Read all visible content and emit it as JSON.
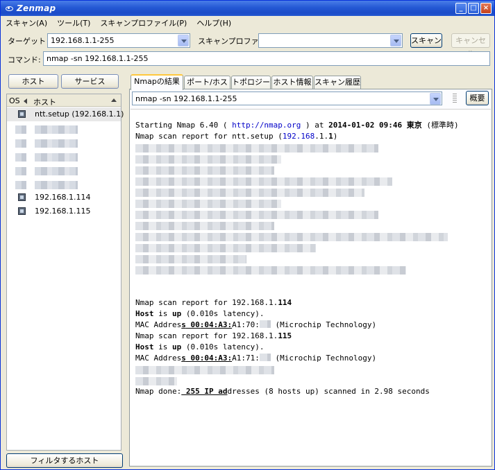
{
  "window": {
    "title": "Zenmap"
  },
  "menu": [
    "スキャン(A)",
    "ツール(T)",
    "スキャンプロファイル(P)",
    "ヘルプ(H)"
  ],
  "target": {
    "label": "ターゲット",
    "value": "192.168.1.1-255"
  },
  "profile": {
    "label": "スキャンプロファイル",
    "value": ""
  },
  "buttons": {
    "scan": "スキャン",
    "cancel": "キャンセル",
    "filter_hosts": "フィルタするホスト"
  },
  "command": {
    "label": "コマンド:",
    "value": "nmap -sn 192.168.1.1-255"
  },
  "host_tabs": {
    "hosts": "ホスト",
    "services": "サービス"
  },
  "host_list": {
    "col_os": "OS",
    "col_host": "ホスト",
    "hosts": [
      "ntt.setup (192.168.1.1)",
      "192.168.1.114",
      "192.168.1.115"
    ]
  },
  "result_tabs": [
    "Nmapの結果",
    "ポート/ホスト",
    "トポロジー",
    "ホスト情報",
    "スキャン履歴"
  ],
  "scan_select": {
    "value": "nmap -sn 192.168.1.1-255"
  },
  "overview_button": "概要",
  "output": {
    "line1_start": "Starting Nmap 6.40 ( ",
    "line1_url": "http://nmap.org",
    "line1_mid": " ) at ",
    "line1_date": "2014-01-02 09:46 東京",
    "line1_tz": " (標準時)",
    "line2_text": "Nmap scan report for ntt.setup (",
    "line2_ip_a": "192.168",
    "line2_ip_b": ".1.",
    "line2_ip_c": "1",
    "line2_close": ")",
    "r114_prefix": "Nmap scan report for 192.168.1.",
    "r114_last": "114",
    "up_host": "Host",
    "up_is": " is ",
    "up_word": "up",
    "up_rest": " (0.010s latency).",
    "mac_label": "MAC Addres",
    "mac_s": "s",
    "mac_prefix": " 00:04:A3",
    "mac_colon": ":",
    "mac_114": "A1:70:",
    "mac_vendor": " (Microchip Technology)",
    "r115_last": "115",
    "mac_115": "A1:71:",
    "done_prefix": "Nmap done:",
    "done_num": " 255 IP ad",
    "done_rest": "dresses (8 hosts up) scanned in 2.98 seconds"
  }
}
